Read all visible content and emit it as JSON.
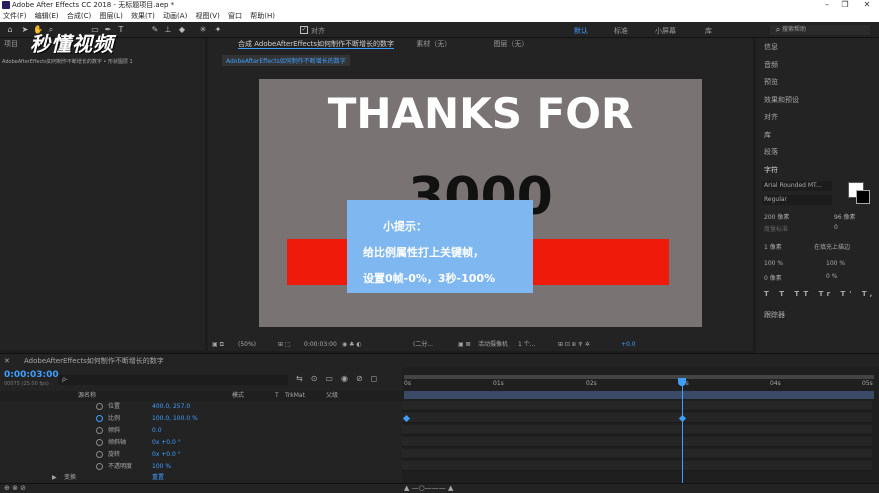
{
  "window": {
    "title": "Adobe After Effects CC 2018 - 无标题项目.aep *"
  },
  "menu": [
    "文件(F)",
    "编辑(E)",
    "合成(C)",
    "图层(L)",
    "效果(T)",
    "动画(A)",
    "视图(V)",
    "窗口",
    "帮助(H)"
  ],
  "toolbar": {
    "align_label": "对齐",
    "workspaces": [
      "默认",
      "标准",
      "小屏幕",
      "库"
    ],
    "search_placeholder": "搜索帮助"
  },
  "watermark": "秒懂视频",
  "project_panel": {
    "tab": "项目",
    "path": "AdobeAfterEffects如何制作不断增长的数字 • 形状图层 1"
  },
  "comp_panel": {
    "tab": "合成 AdobeAfterEffects如何制作不断增长的数字",
    "footage_tab": "素材（无）",
    "layer_tab": "图层（无）",
    "breadcrumb": "AdobeAfterEffects如何制作不断增长的数字"
  },
  "canvas": {
    "headline": "THANKS FOR",
    "number": "3000",
    "bg_color": "#7a7374",
    "bar_color": "#f01a0a"
  },
  "hint": {
    "title": "小提示：",
    "line1": "给比例属性打上关键帧，",
    "line2": "设置0帧-0%，3秒-100%",
    "color": "#7fb8f0"
  },
  "viewer_bar": {
    "zoom": "(50%)",
    "timecode": "0:00:03:00",
    "resolution": "(二分...",
    "camera": "活动摄像机",
    "views": "1 个...",
    "exposure": "+0.0"
  },
  "right_panel": {
    "items": [
      "信息",
      "音频",
      "预览",
      "效果和预设",
      "对齐",
      "库",
      "段落",
      "字符"
    ],
    "font": "Arial Rounded MT...",
    "style": "Regular",
    "font_size": "200 像素",
    "leading": "96 像素",
    "tracking_label": "度量标准",
    "tracking_value": "0",
    "stroke": "1 像素",
    "stroke_mode": "在填充上描边",
    "v_scale": "100 %",
    "h_scale": "100 %",
    "baseline": "0 像素",
    "tsume": "0 %",
    "tracker": "跟踪器"
  },
  "timeline": {
    "tab": "AdobeAfterEffects如何制作不断增长的数字",
    "timecode": "0:00:03:00",
    "timecode_sub": "00075 (25.00 fps)",
    "search_placeholder": "ρ-",
    "columns": [
      "源名称",
      "模式",
      "T",
      "TrkMat",
      "父级"
    ],
    "ruler": [
      "0s",
      "01s",
      "02s",
      "03s",
      "04s",
      "05s"
    ],
    "current_time_seconds": 3,
    "properties": [
      {
        "name": "位置",
        "value": "400.0, 257.0"
      },
      {
        "name": "比例",
        "value": "100.0, 100.0 %"
      },
      {
        "name": "倾斜",
        "value": "0.0"
      },
      {
        "name": "倾斜轴",
        "value": "0x +0.0 °"
      },
      {
        "name": "旋转",
        "value": "0x +0.0 °"
      },
      {
        "name": "不透明度",
        "value": "100 %"
      }
    ],
    "transform_label": "变换",
    "reset_label": "重置"
  }
}
